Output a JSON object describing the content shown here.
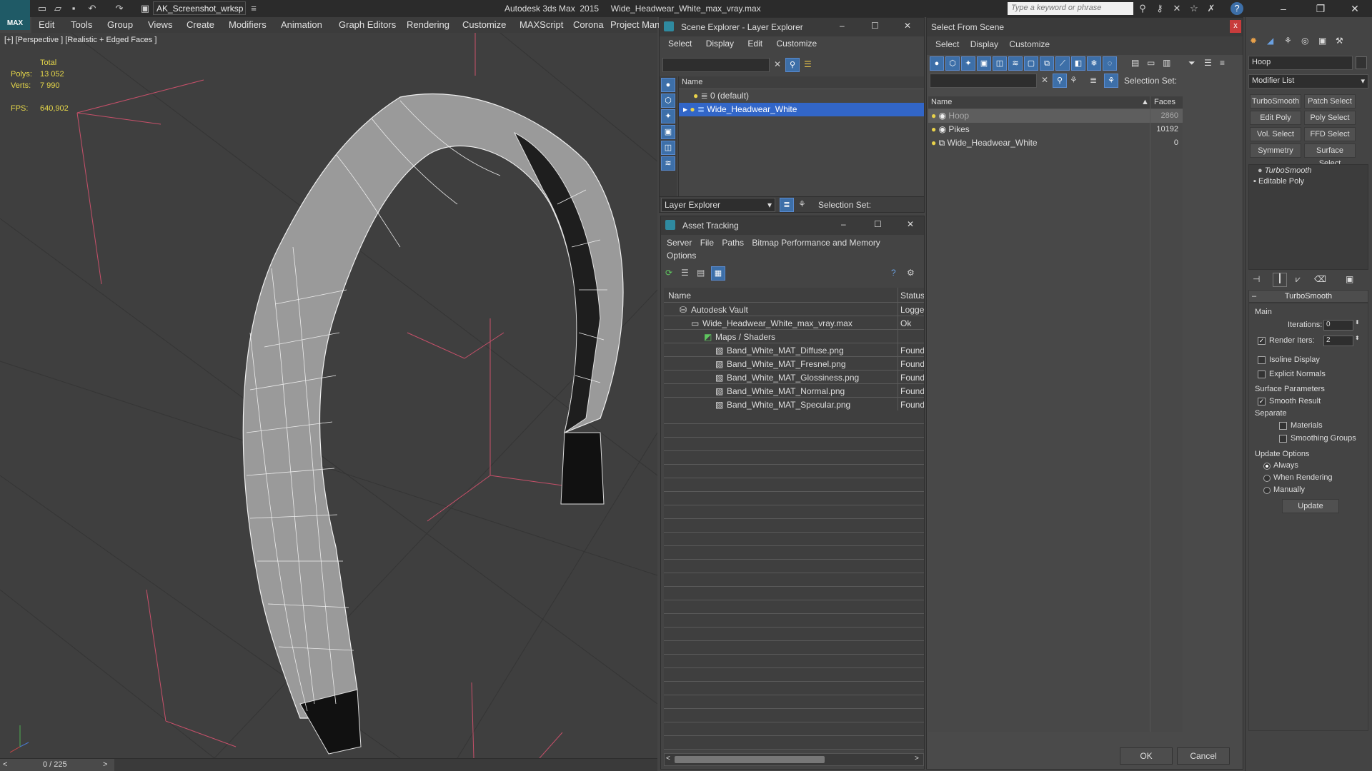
{
  "app": {
    "title": "Autodesk 3ds Max  2015     Wide_Headwear_White_max_vray.max",
    "workspace": "AK_Screenshot_wrksp",
    "search_placeholder": "Type a keyword or phrase",
    "logo_text": "MAX"
  },
  "menu": [
    "Edit",
    "Tools",
    "Group",
    "Views",
    "Create",
    "Modifiers",
    "Animation",
    "Graph Editors",
    "Rendering",
    "Customize",
    "MAXScript",
    "Corona",
    "Project Man"
  ],
  "viewport": {
    "label": "[+] [Perspective ] [Realistic + Edged Faces ]",
    "stats": {
      "total_label": "Total",
      "polys_label": "Polys:",
      "polys": "13 052",
      "verts_label": "Verts:",
      "verts": "7 990",
      "fps_label": "FPS:",
      "fps": "640,902"
    },
    "timeline": "0 / 225"
  },
  "scene_explorer": {
    "title": "Scene Explorer - Layer Explorer",
    "menu": [
      "Select",
      "Display",
      "Edit",
      "Customize"
    ],
    "column": "Name",
    "rows": [
      "0 (default)",
      "Wide_Headwear_White"
    ],
    "footer_dropdown": "Layer Explorer",
    "selection_set_label": "Selection Set:"
  },
  "asset_tracking": {
    "title": "Asset Tracking",
    "menu": [
      "Server",
      "File",
      "Paths",
      "Bitmap Performance and Memory",
      "Options"
    ],
    "columns": {
      "name": "Name",
      "status": "Status"
    },
    "rows": [
      {
        "name": "Autodesk Vault",
        "status": "Logge"
      },
      {
        "name": "Wide_Headwear_White_max_vray.max",
        "status": "Ok"
      },
      {
        "name": "Maps / Shaders",
        "status": ""
      },
      {
        "name": "Band_White_MAT_Diffuse.png",
        "status": "Found"
      },
      {
        "name": "Band_White_MAT_Fresnel.png",
        "status": "Found"
      },
      {
        "name": "Band_White_MAT_Glossiness.png",
        "status": "Found"
      },
      {
        "name": "Band_White_MAT_Normal.png",
        "status": "Found"
      },
      {
        "name": "Band_White_MAT_Specular.png",
        "status": "Found"
      }
    ]
  },
  "select_from_scene": {
    "title": "Select From Scene",
    "close": "x",
    "menu": [
      "Select",
      "Display",
      "Customize"
    ],
    "selection_set_label": "Selection Set:",
    "columns": {
      "name": "Name",
      "faces": "Faces"
    },
    "rows": [
      {
        "name": "Hoop",
        "faces": "2860"
      },
      {
        "name": "Pikes",
        "faces": "10192"
      },
      {
        "name": "Wide_Headwear_White",
        "faces": "0"
      }
    ],
    "ok": "OK",
    "cancel": "Cancel"
  },
  "command_panel": {
    "object_name": "Hoop",
    "modifier_list": "Modifier List",
    "buttons": [
      "TurboSmooth",
      "Patch Select",
      "Edit Poly",
      "Poly Select",
      "Vol. Select",
      "FFD Select",
      "Symmetry",
      "Surface Select"
    ],
    "stack": [
      "TurboSmooth",
      "Editable Poly"
    ],
    "rollout_title": "TurboSmooth",
    "main_label": "Main",
    "iterations_label": "Iterations:",
    "iterations": "0",
    "render_iters_label": "Render Iters:",
    "render_iters": "2",
    "isoline": "Isoline Display",
    "explicit_normals": "Explicit Normals",
    "surface_params": "Surface Parameters",
    "smooth_result": "Smooth Result",
    "separate": "Separate",
    "materials": "Materials",
    "smoothing_groups": "Smoothing Groups",
    "update_options": "Update Options",
    "always": "Always",
    "when_rendering": "When Rendering",
    "manually": "Manually",
    "update": "Update"
  }
}
